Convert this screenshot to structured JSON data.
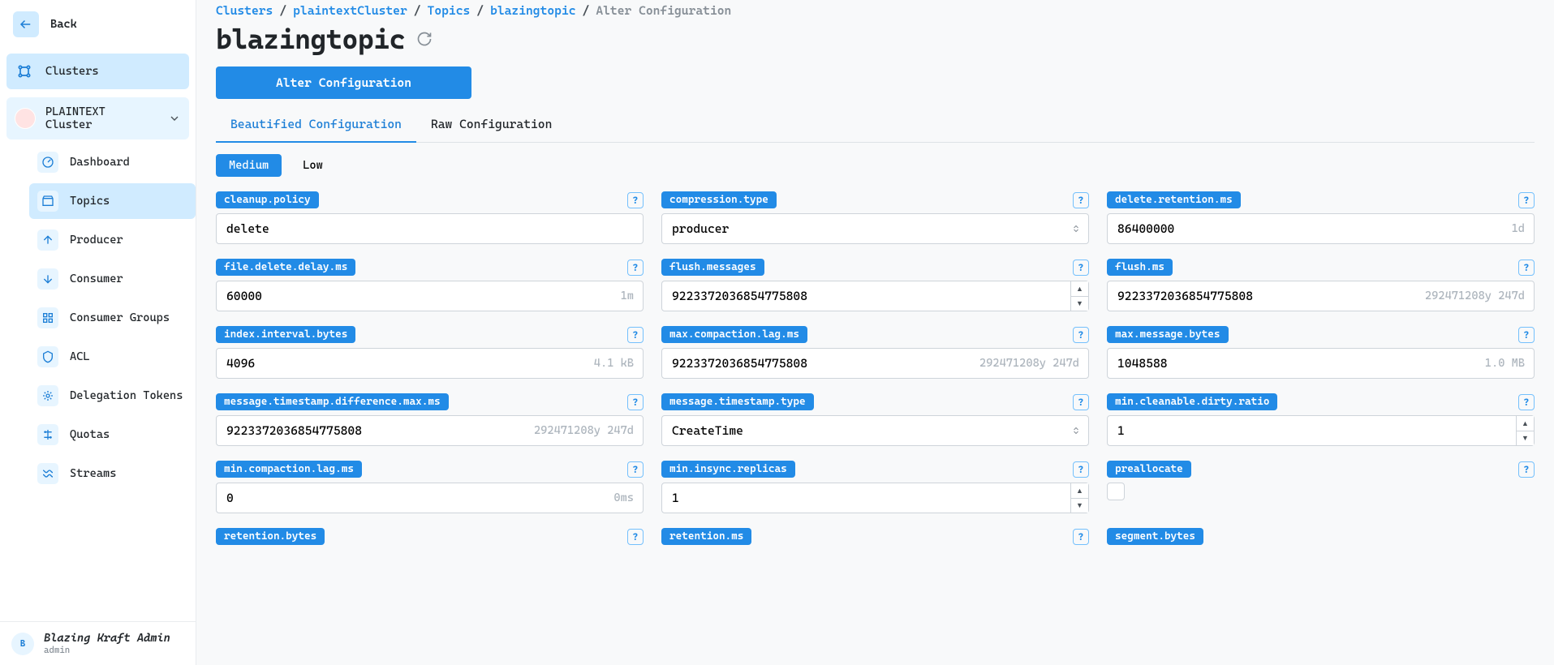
{
  "back_label": "Back",
  "sidebar": {
    "clusters_label": "Clusters",
    "cluster_name": "PLAINTEXT Cluster",
    "items": [
      {
        "label": "Dashboard"
      },
      {
        "label": "Topics"
      },
      {
        "label": "Producer"
      },
      {
        "label": "Consumer"
      },
      {
        "label": "Consumer Groups"
      },
      {
        "label": "ACL"
      },
      {
        "label": "Delegation Tokens"
      },
      {
        "label": "Quotas"
      },
      {
        "label": "Streams"
      }
    ]
  },
  "user": {
    "initial": "B",
    "name": "Blazing Kraft Admin",
    "role": "admin"
  },
  "breadcrumb": {
    "clusters": "Clusters",
    "cluster": "plaintextCluster",
    "topics": "Topics",
    "topic": "blazingtopic",
    "current": "Alter Configuration"
  },
  "page_title": "blazingtopic",
  "alter_btn": "Alter Configuration",
  "tabs": {
    "beautified": "Beautified Configuration",
    "raw": "Raw Configuration"
  },
  "pills": {
    "medium": "Medium",
    "low": "Low"
  },
  "fields": {
    "cleanup_policy": {
      "label": "cleanup.policy",
      "value": "delete"
    },
    "compression_type": {
      "label": "compression.type",
      "value": "producer"
    },
    "delete_retention_ms": {
      "label": "delete.retention.ms",
      "value": "86400000",
      "hint": "1d"
    },
    "file_delete_delay_ms": {
      "label": "file.delete.delay.ms",
      "value": "60000",
      "hint": "1m"
    },
    "flush_messages": {
      "label": "flush.messages",
      "value": "9223372036854775808"
    },
    "flush_ms": {
      "label": "flush.ms",
      "value": "9223372036854775808",
      "hint": "292471208y 247d"
    },
    "index_interval_bytes": {
      "label": "index.interval.bytes",
      "value": "4096",
      "hint": "4.1 kB"
    },
    "max_compaction_lag_ms": {
      "label": "max.compaction.lag.ms",
      "value": "9223372036854775808",
      "hint": "292471208y 247d"
    },
    "max_message_bytes": {
      "label": "max.message.bytes",
      "value": "1048588",
      "hint": "1.0 MB"
    },
    "message_timestamp_difference_max_ms": {
      "label": "message.timestamp.difference.max.ms",
      "value": "9223372036854775808",
      "hint": "292471208y 247d"
    },
    "message_timestamp_type": {
      "label": "message.timestamp.type",
      "value": "CreateTime"
    },
    "min_cleanable_dirty_ratio": {
      "label": "min.cleanable.dirty.ratio",
      "value": "1"
    },
    "min_compaction_lag_ms": {
      "label": "min.compaction.lag.ms",
      "value": "0",
      "hint": "0ms"
    },
    "min_insync_replicas": {
      "label": "min.insync.replicas",
      "value": "1"
    },
    "preallocate": {
      "label": "preallocate"
    },
    "retention_bytes": {
      "label": "retention.bytes"
    },
    "retention_ms": {
      "label": "retention.ms"
    },
    "segment_bytes": {
      "label": "segment.bytes"
    }
  }
}
